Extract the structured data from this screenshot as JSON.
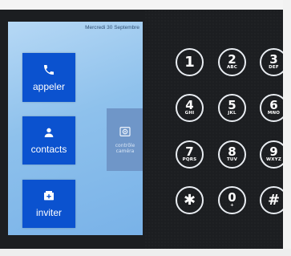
{
  "screen": {
    "date": "Mercredi 30 Septembre",
    "tiles": [
      {
        "label": "appeler",
        "icon": "phone-icon"
      },
      {
        "label": "contacts",
        "icon": "person-icon"
      },
      {
        "label": "inviter",
        "icon": "add-contact-icon"
      }
    ],
    "camera_tile": {
      "label": "contrôle caméra",
      "icon": "camera-icon"
    }
  },
  "keypad": [
    {
      "digit": "1",
      "letters": ""
    },
    {
      "digit": "2",
      "letters": "ABC"
    },
    {
      "digit": "3",
      "letters": "DEF"
    },
    {
      "digit": "4",
      "letters": "GHI"
    },
    {
      "digit": "5",
      "letters": "JKL"
    },
    {
      "digit": "6",
      "letters": "MNO"
    },
    {
      "digit": "7",
      "letters": "PQRS"
    },
    {
      "digit": "8",
      "letters": "TUV"
    },
    {
      "digit": "9",
      "letters": "WXYZ"
    },
    {
      "digit": "✱",
      "letters": ""
    },
    {
      "digit": "0",
      "letters": "+"
    },
    {
      "digit": "#",
      "letters": ""
    }
  ],
  "colors": {
    "tile": "#0b52cf",
    "screen": "#8ec1ec",
    "device": "#1c1e21",
    "key_ring": "#e9edf2"
  }
}
